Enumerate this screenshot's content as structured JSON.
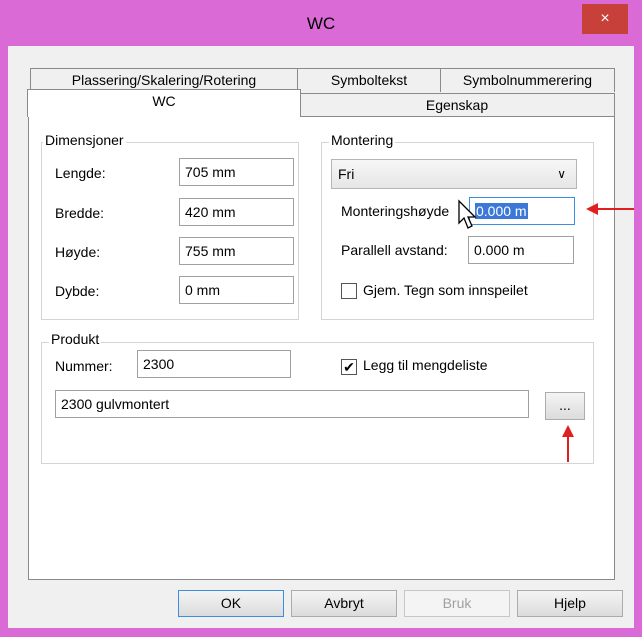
{
  "window": {
    "title": "WC",
    "close_icon": "×",
    "accent": "#d96ad6",
    "close_color": "#c7413a"
  },
  "tabs": {
    "row1": [
      "Plassering/Skalering/Rotering",
      "Symboltekst",
      "Symbolnummerering"
    ],
    "row2": [
      "WC",
      "Egenskap"
    ]
  },
  "dimensjoner": {
    "title": "Dimensjoner",
    "rows": [
      {
        "label": "Lengde:",
        "value": "705 mm"
      },
      {
        "label": "Bredde:",
        "value": "420 mm"
      },
      {
        "label": "Høyde:",
        "value": "755 mm"
      },
      {
        "label": "Dybde:",
        "value": "0 mm"
      }
    ]
  },
  "montering": {
    "title": "Montering",
    "type_value": "Fri",
    "height_label": "Monteringshøyde",
    "height_value": "0.000 m",
    "parallel_label": "Parallell avstand:",
    "parallel_value": "0.000 m",
    "hide_label": "Gjem. Tegn som innspeilet",
    "hide_checked": false
  },
  "produkt": {
    "title": "Produkt",
    "number_label": "Nummer:",
    "number_value": "2300",
    "quantity_label": "Legg til mengdeliste",
    "quantity_checked": true,
    "description_value": "2300 gulvmontert",
    "browse_label": "..."
  },
  "buttons": {
    "ok": "OK",
    "cancel": "Avbryt",
    "apply": "Bruk",
    "help": "Hjelp"
  },
  "annotations": {
    "arrow_color": "#e02020"
  }
}
